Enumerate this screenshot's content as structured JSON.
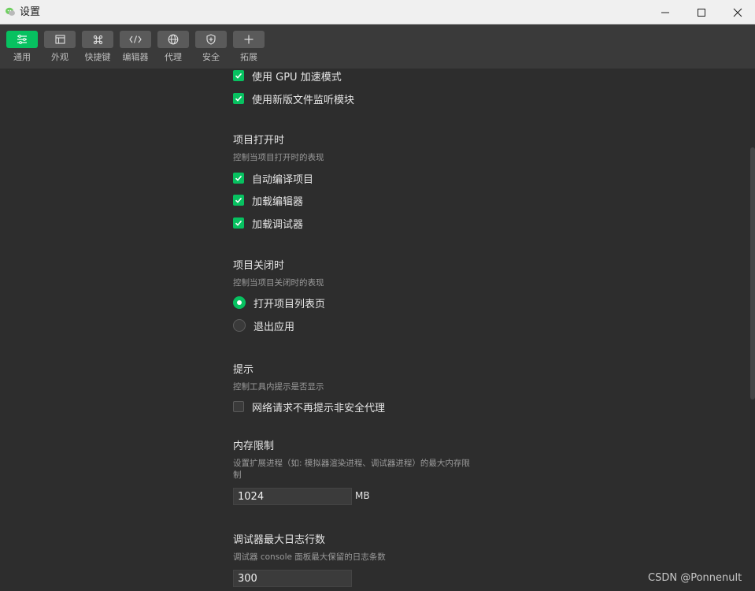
{
  "window": {
    "title": "设置"
  },
  "toolbar": {
    "items": [
      {
        "label": "通用",
        "icon": "settings-list-icon"
      },
      {
        "label": "外观",
        "icon": "window-icon"
      },
      {
        "label": "快捷键",
        "icon": "command-key-icon"
      },
      {
        "label": "编辑器",
        "icon": "code-icon"
      },
      {
        "label": "代理",
        "icon": "globe-icon"
      },
      {
        "label": "安全",
        "icon": "shield-icon"
      },
      {
        "label": "拓展",
        "icon": "plus-icon"
      }
    ],
    "active": "通用"
  },
  "top_options": [
    {
      "label": "使用 GPU 加速模式",
      "checked": true
    },
    {
      "label": "使用新版文件监听模块",
      "checked": true
    }
  ],
  "project_open": {
    "title": "项目打开时",
    "desc": "控制当项目打开时的表现",
    "options": [
      {
        "label": "自动编译项目",
        "checked": true
      },
      {
        "label": "加载编辑器",
        "checked": true
      },
      {
        "label": "加载调试器",
        "checked": true
      }
    ]
  },
  "project_close": {
    "title": "项目关闭时",
    "desc": "控制当项目关闭时的表现",
    "options": [
      {
        "label": "打开项目列表页",
        "selected": true
      },
      {
        "label": "退出应用",
        "selected": false
      }
    ]
  },
  "hints": {
    "title": "提示",
    "desc": "控制工具内提示是否显示",
    "option": {
      "label": "网络请求不再提示非安全代理",
      "checked": false
    }
  },
  "memory": {
    "title": "内存限制",
    "desc_line1": "设置扩展进程（如: 模拟器渲染进程、调试器进程）的最大内存限",
    "desc_line2": "制",
    "value": "1024",
    "unit": "MB"
  },
  "debugger_log": {
    "title": "调试器最大日志行数",
    "desc": "调试器 console 面板最大保留的日志条数",
    "value": "300"
  },
  "watermark": "CSDN @Ponnenult",
  "colors": {
    "accent": "#07c160",
    "background": "#2d2d2d",
    "toolbar": "#3a3a3a",
    "titlebar": "#f0f0f0"
  }
}
